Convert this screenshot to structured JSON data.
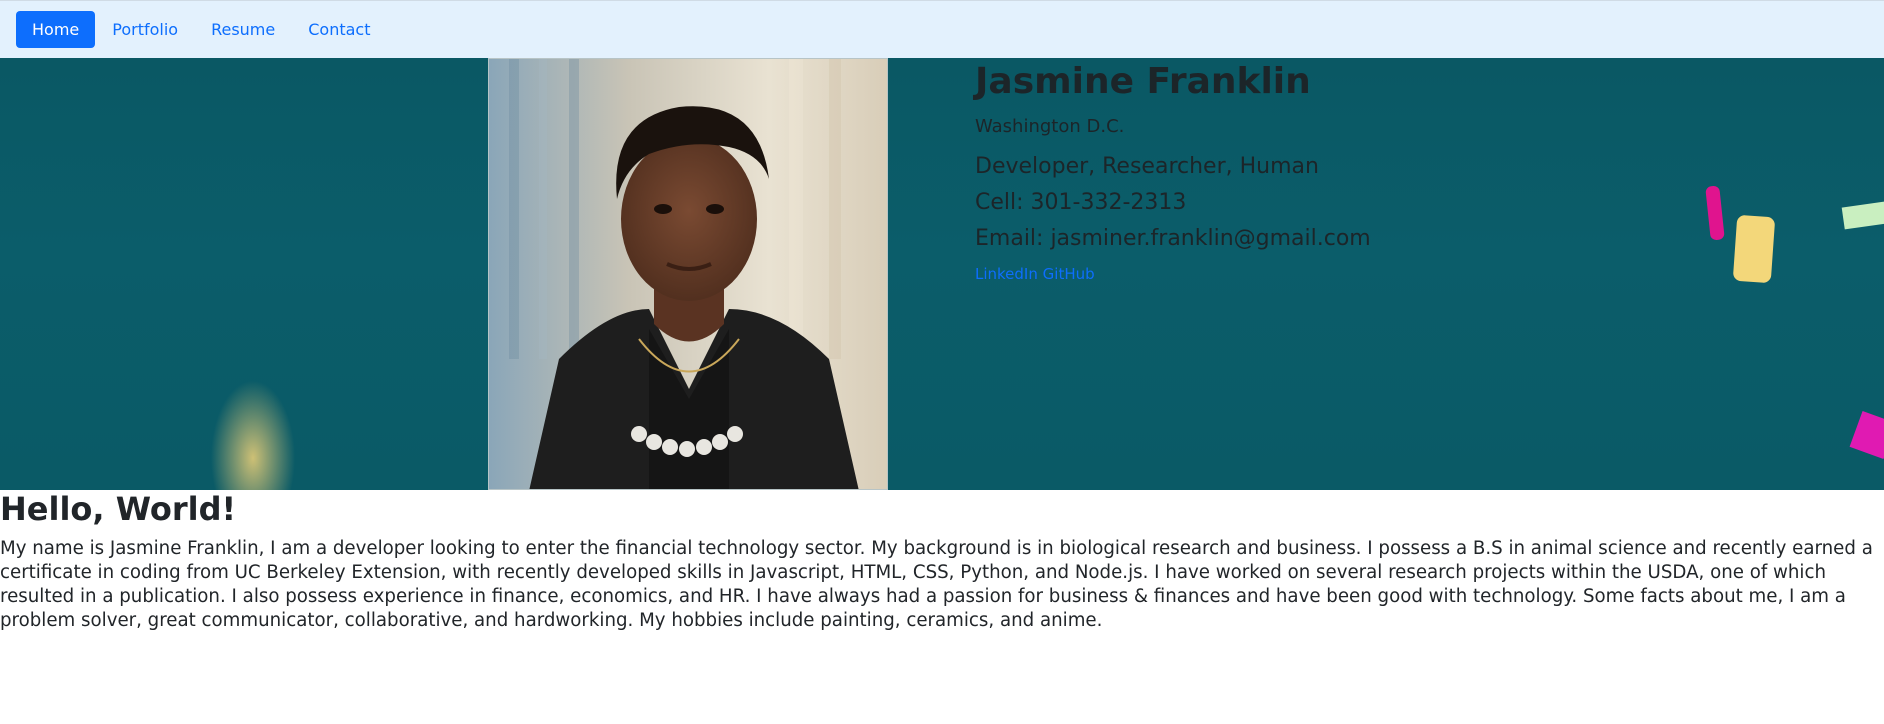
{
  "nav": {
    "items": [
      {
        "label": "Home",
        "active": true
      },
      {
        "label": "Portfolio",
        "active": false
      },
      {
        "label": "Resume",
        "active": false
      },
      {
        "label": "Contact",
        "active": false
      }
    ]
  },
  "profile": {
    "name": "Jasmine Franklin",
    "location": "Washington D.C.",
    "roles": "Developer, Researcher, Human",
    "cell": "Cell: 301-332-2313",
    "email": "Email: jasminer.franklin@gmail.com",
    "links": {
      "linkedin": "LinkedIn",
      "github": "GitHub"
    }
  },
  "about": {
    "heading": "Hello, World!",
    "body": "My name is Jasmine Franklin, I am a developer looking to enter the financial technology sector. My background is in biological research and business. I possess a B.S in animal science and recently earned a certificate in coding from UC Berkeley Extension, with recently developed skills in Javascript, HTML, CSS, Python, and Node.js. I have worked on several research projects within the USDA, one of which resulted in a publication. I also possess experience in finance, economics, and HR. I have always had a passion for business & finances and have been good with technology. Some facts about me, I am a problem solver, great communicator, collaborative, and hardworking. My hobbies include painting, ceramics, and anime."
  },
  "colors": {
    "navbar_bg": "#e3f1fd",
    "accent": "#0d6efd",
    "hero_bg": "#0a5864"
  }
}
